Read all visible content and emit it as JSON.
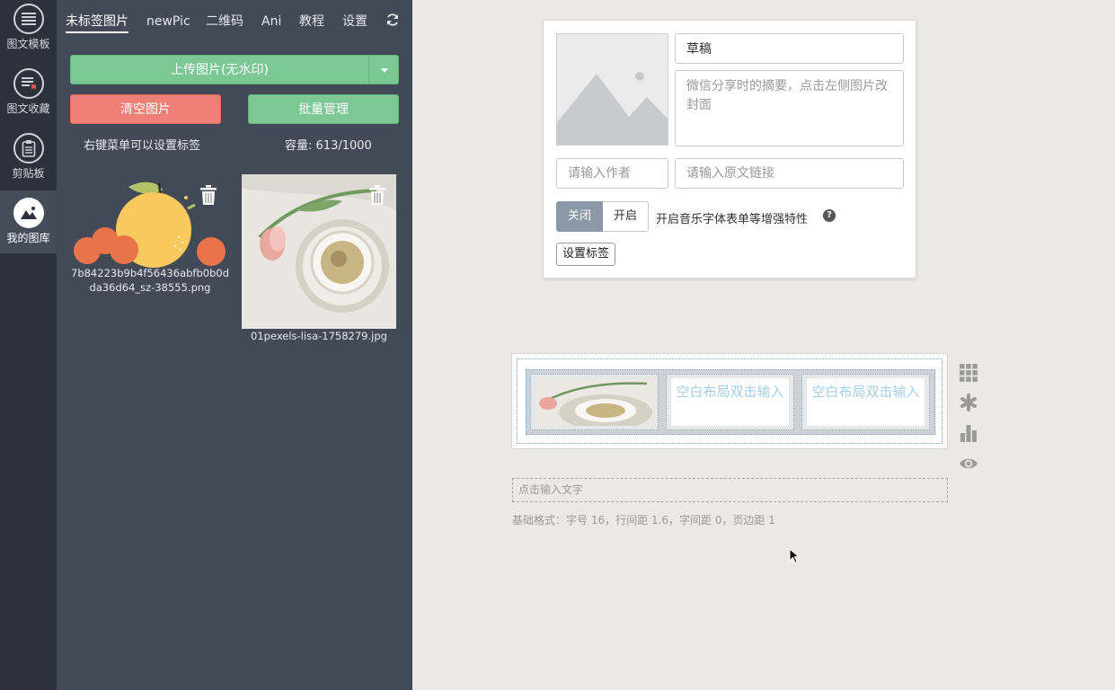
{
  "rail": {
    "items": [
      {
        "label": "图文模板",
        "icon": "list-icon"
      },
      {
        "label": "图文收藏",
        "icon": "bookmark-list-icon"
      },
      {
        "label": "剪贴板",
        "icon": "clipboard-icon"
      },
      {
        "label": "我的图库",
        "icon": "image-gallery-icon"
      }
    ]
  },
  "panel": {
    "tabs": [
      {
        "label": "未标签图片",
        "active": true
      },
      {
        "label": "newPic"
      },
      {
        "label": "二维码"
      },
      {
        "label": "Ani"
      },
      {
        "label": "教程"
      },
      {
        "label": "设置"
      }
    ],
    "upload_label": "上传图片(无水印)",
    "clear_label": "清空图片",
    "batch_label": "批量管理",
    "hint": "右键菜单可以设置标签",
    "capacity_label": "容量:",
    "capacity_value": "613/1000",
    "images": [
      {
        "name": "7b84223b9b4f56436abfb0b0dda36d64_sz-38555.png"
      },
      {
        "name": "01pexels-lisa-1758279.jpg"
      }
    ]
  },
  "editor": {
    "title_value": "草稿",
    "summary_placeholder": "微信分享时的摘要，点击左侧图片改封面",
    "author_placeholder": "请输入作者",
    "link_placeholder": "请输入原文链接",
    "toggle_off": "关闭",
    "toggle_on": "开启",
    "toggle_label": "开启音乐字体表单等增强特性",
    "help_glyph": "?",
    "tag_button": "设置标签",
    "layout_cells": [
      "空白布局双击输入",
      "空白布局双击输入"
    ],
    "text_placeholder": "点击输入文字",
    "format": {
      "prefix": "基础格式：",
      "font_size": "字号 16，",
      "line_height": "行间距 1.6，",
      "letter_spacing": "字间距 0，",
      "page_margin": "页边距 1"
    }
  },
  "colors": {
    "rail_bg": "#2c313b",
    "panel_bg": "#434a57",
    "green": "#7cc894",
    "red": "#f07f78",
    "toggle_off_bg": "#8b98a6"
  }
}
